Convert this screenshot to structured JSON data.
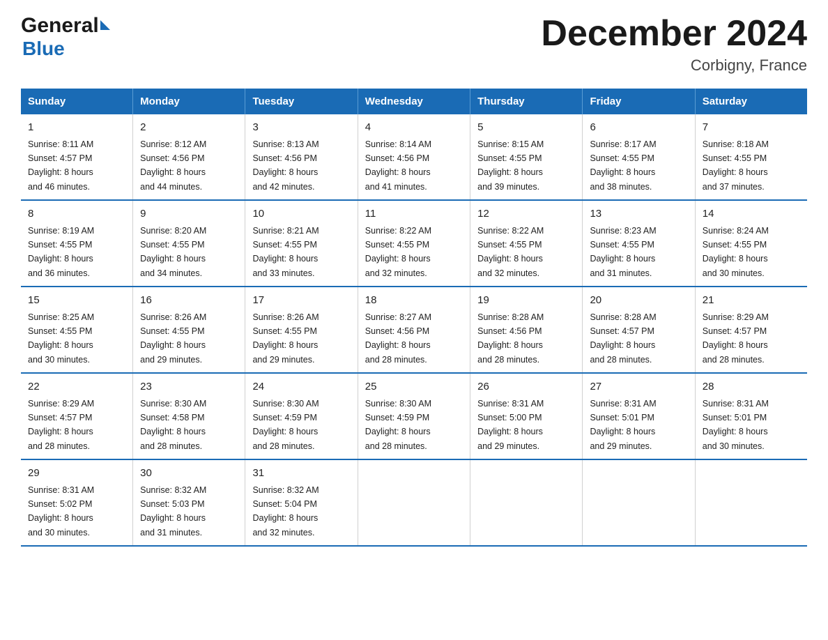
{
  "logo": {
    "general": "General",
    "blue": "Blue",
    "triangle": "▶"
  },
  "header": {
    "title": "December 2024",
    "location": "Corbigny, France"
  },
  "days_of_week": [
    "Sunday",
    "Monday",
    "Tuesday",
    "Wednesday",
    "Thursday",
    "Friday",
    "Saturday"
  ],
  "weeks": [
    [
      {
        "day": "1",
        "sunrise": "Sunrise: 8:11 AM",
        "sunset": "Sunset: 4:57 PM",
        "daylight": "Daylight: 8 hours",
        "daylight2": "and 46 minutes."
      },
      {
        "day": "2",
        "sunrise": "Sunrise: 8:12 AM",
        "sunset": "Sunset: 4:56 PM",
        "daylight": "Daylight: 8 hours",
        "daylight2": "and 44 minutes."
      },
      {
        "day": "3",
        "sunrise": "Sunrise: 8:13 AM",
        "sunset": "Sunset: 4:56 PM",
        "daylight": "Daylight: 8 hours",
        "daylight2": "and 42 minutes."
      },
      {
        "day": "4",
        "sunrise": "Sunrise: 8:14 AM",
        "sunset": "Sunset: 4:56 PM",
        "daylight": "Daylight: 8 hours",
        "daylight2": "and 41 minutes."
      },
      {
        "day": "5",
        "sunrise": "Sunrise: 8:15 AM",
        "sunset": "Sunset: 4:55 PM",
        "daylight": "Daylight: 8 hours",
        "daylight2": "and 39 minutes."
      },
      {
        "day": "6",
        "sunrise": "Sunrise: 8:17 AM",
        "sunset": "Sunset: 4:55 PM",
        "daylight": "Daylight: 8 hours",
        "daylight2": "and 38 minutes."
      },
      {
        "day": "7",
        "sunrise": "Sunrise: 8:18 AM",
        "sunset": "Sunset: 4:55 PM",
        "daylight": "Daylight: 8 hours",
        "daylight2": "and 37 minutes."
      }
    ],
    [
      {
        "day": "8",
        "sunrise": "Sunrise: 8:19 AM",
        "sunset": "Sunset: 4:55 PM",
        "daylight": "Daylight: 8 hours",
        "daylight2": "and 36 minutes."
      },
      {
        "day": "9",
        "sunrise": "Sunrise: 8:20 AM",
        "sunset": "Sunset: 4:55 PM",
        "daylight": "Daylight: 8 hours",
        "daylight2": "and 34 minutes."
      },
      {
        "day": "10",
        "sunrise": "Sunrise: 8:21 AM",
        "sunset": "Sunset: 4:55 PM",
        "daylight": "Daylight: 8 hours",
        "daylight2": "and 33 minutes."
      },
      {
        "day": "11",
        "sunrise": "Sunrise: 8:22 AM",
        "sunset": "Sunset: 4:55 PM",
        "daylight": "Daylight: 8 hours",
        "daylight2": "and 32 minutes."
      },
      {
        "day": "12",
        "sunrise": "Sunrise: 8:22 AM",
        "sunset": "Sunset: 4:55 PM",
        "daylight": "Daylight: 8 hours",
        "daylight2": "and 32 minutes."
      },
      {
        "day": "13",
        "sunrise": "Sunrise: 8:23 AM",
        "sunset": "Sunset: 4:55 PM",
        "daylight": "Daylight: 8 hours",
        "daylight2": "and 31 minutes."
      },
      {
        "day": "14",
        "sunrise": "Sunrise: 8:24 AM",
        "sunset": "Sunset: 4:55 PM",
        "daylight": "Daylight: 8 hours",
        "daylight2": "and 30 minutes."
      }
    ],
    [
      {
        "day": "15",
        "sunrise": "Sunrise: 8:25 AM",
        "sunset": "Sunset: 4:55 PM",
        "daylight": "Daylight: 8 hours",
        "daylight2": "and 30 minutes."
      },
      {
        "day": "16",
        "sunrise": "Sunrise: 8:26 AM",
        "sunset": "Sunset: 4:55 PM",
        "daylight": "Daylight: 8 hours",
        "daylight2": "and 29 minutes."
      },
      {
        "day": "17",
        "sunrise": "Sunrise: 8:26 AM",
        "sunset": "Sunset: 4:55 PM",
        "daylight": "Daylight: 8 hours",
        "daylight2": "and 29 minutes."
      },
      {
        "day": "18",
        "sunrise": "Sunrise: 8:27 AM",
        "sunset": "Sunset: 4:56 PM",
        "daylight": "Daylight: 8 hours",
        "daylight2": "and 28 minutes."
      },
      {
        "day": "19",
        "sunrise": "Sunrise: 8:28 AM",
        "sunset": "Sunset: 4:56 PM",
        "daylight": "Daylight: 8 hours",
        "daylight2": "and 28 minutes."
      },
      {
        "day": "20",
        "sunrise": "Sunrise: 8:28 AM",
        "sunset": "Sunset: 4:57 PM",
        "daylight": "Daylight: 8 hours",
        "daylight2": "and 28 minutes."
      },
      {
        "day": "21",
        "sunrise": "Sunrise: 8:29 AM",
        "sunset": "Sunset: 4:57 PM",
        "daylight": "Daylight: 8 hours",
        "daylight2": "and 28 minutes."
      }
    ],
    [
      {
        "day": "22",
        "sunrise": "Sunrise: 8:29 AM",
        "sunset": "Sunset: 4:57 PM",
        "daylight": "Daylight: 8 hours",
        "daylight2": "and 28 minutes."
      },
      {
        "day": "23",
        "sunrise": "Sunrise: 8:30 AM",
        "sunset": "Sunset: 4:58 PM",
        "daylight": "Daylight: 8 hours",
        "daylight2": "and 28 minutes."
      },
      {
        "day": "24",
        "sunrise": "Sunrise: 8:30 AM",
        "sunset": "Sunset: 4:59 PM",
        "daylight": "Daylight: 8 hours",
        "daylight2": "and 28 minutes."
      },
      {
        "day": "25",
        "sunrise": "Sunrise: 8:30 AM",
        "sunset": "Sunset: 4:59 PM",
        "daylight": "Daylight: 8 hours",
        "daylight2": "and 28 minutes."
      },
      {
        "day": "26",
        "sunrise": "Sunrise: 8:31 AM",
        "sunset": "Sunset: 5:00 PM",
        "daylight": "Daylight: 8 hours",
        "daylight2": "and 29 minutes."
      },
      {
        "day": "27",
        "sunrise": "Sunrise: 8:31 AM",
        "sunset": "Sunset: 5:01 PM",
        "daylight": "Daylight: 8 hours",
        "daylight2": "and 29 minutes."
      },
      {
        "day": "28",
        "sunrise": "Sunrise: 8:31 AM",
        "sunset": "Sunset: 5:01 PM",
        "daylight": "Daylight: 8 hours",
        "daylight2": "and 30 minutes."
      }
    ],
    [
      {
        "day": "29",
        "sunrise": "Sunrise: 8:31 AM",
        "sunset": "Sunset: 5:02 PM",
        "daylight": "Daylight: 8 hours",
        "daylight2": "and 30 minutes."
      },
      {
        "day": "30",
        "sunrise": "Sunrise: 8:32 AM",
        "sunset": "Sunset: 5:03 PM",
        "daylight": "Daylight: 8 hours",
        "daylight2": "and 31 minutes."
      },
      {
        "day": "31",
        "sunrise": "Sunrise: 8:32 AM",
        "sunset": "Sunset: 5:04 PM",
        "daylight": "Daylight: 8 hours",
        "daylight2": "and 32 minutes."
      },
      null,
      null,
      null,
      null
    ]
  ]
}
